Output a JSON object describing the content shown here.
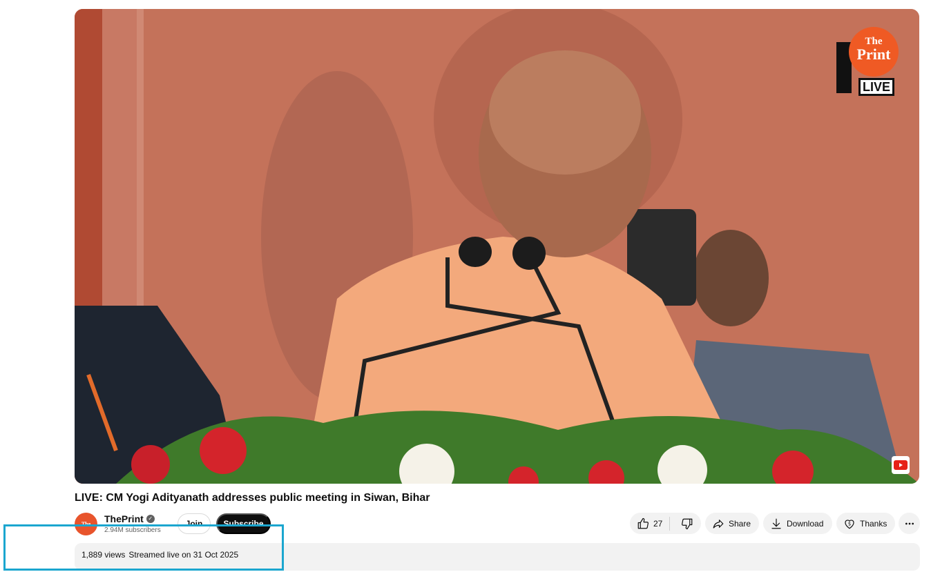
{
  "video": {
    "watermark_the": "The",
    "watermark_print": "Print",
    "watermark_live": "LIVE",
    "title": "LIVE: CM Yogi Adityanath addresses public meeting in Siwan, Bihar"
  },
  "channel": {
    "avatar_text": "The Print",
    "name": "ThePrint",
    "subscribers": "2.94M subscribers",
    "join_label": "Join",
    "subscribe_label": "Subscribe"
  },
  "actions": {
    "like_count": "27",
    "share_label": "Share",
    "download_label": "Download",
    "thanks_label": "Thanks"
  },
  "description": {
    "views": "1,889 views",
    "streamed": "Streamed live on 31 Oct 2025"
  },
  "colors": {
    "highlight": "#1ba6cf",
    "subscribe_bg": "#0f0f0f",
    "brand_orange": "#ef5a24"
  }
}
